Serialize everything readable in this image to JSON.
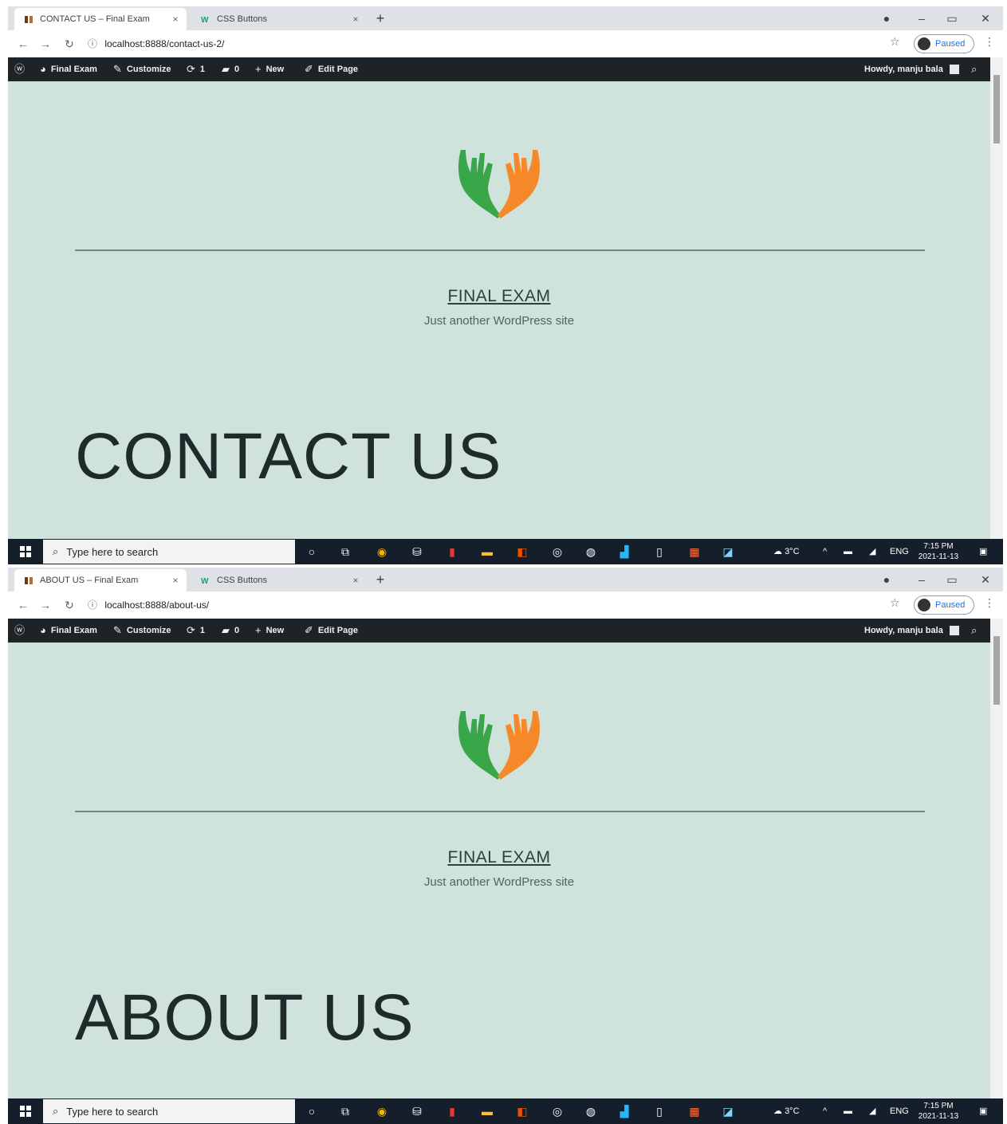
{
  "screens": [
    {
      "tabs": [
        {
          "label": "CONTACT US – Final Exam",
          "close": "×"
        },
        {
          "label": "CSS Buttons",
          "close": "×"
        }
      ],
      "new_tab": "+",
      "url": "localhost:8888/contact-us-2/",
      "profile_label": "Paused",
      "adminbar": {
        "site": "Final Exam",
        "customize": "Customize",
        "updates": "1",
        "comments": "0",
        "new": "New",
        "edit": "Edit Page",
        "howdy": "Howdy, manju bala"
      },
      "site_title": "FINAL EXAM",
      "tagline": "Just another WordPress site",
      "page_heading": "CONTACT US",
      "taskbar": {
        "search_placeholder": "Type here to search",
        "weather": "3°C",
        "lang": "ENG",
        "time": "7:15 PM",
        "date": "2021-11-13"
      }
    },
    {
      "tabs": [
        {
          "label": "ABOUT US – Final Exam",
          "close": "×"
        },
        {
          "label": "CSS Buttons",
          "close": "×"
        }
      ],
      "new_tab": "+",
      "url": "localhost:8888/about-us/",
      "profile_label": "Paused",
      "adminbar": {
        "site": "Final Exam",
        "customize": "Customize",
        "updates": "1",
        "comments": "0",
        "new": "New",
        "edit": "Edit Page",
        "howdy": "Howdy, manju bala"
      },
      "site_title": "FINAL EXAM",
      "tagline": "Just another WordPress site",
      "page_heading": "ABOUT US",
      "taskbar": {
        "search_placeholder": "Type here to search",
        "weather": "3°C",
        "lang": "ENG",
        "time": "7:15 PM",
        "date": "2021-11-13"
      }
    }
  ],
  "colors": {
    "page_bg": "#cfe2dc",
    "adminbar_bg": "#1d2327",
    "taskbar_bg": "#151e2b",
    "logo_green": "#3aa64a",
    "logo_orange": "#f5892a"
  },
  "icons": {
    "wordpress": "wordpress-icon",
    "dashboard": "dashboard-icon",
    "customize": "brush-icon",
    "updates": "refresh-icon",
    "comments": "comment-icon",
    "new": "plus-icon",
    "edit": "pencil-icon",
    "search": "search-icon"
  }
}
